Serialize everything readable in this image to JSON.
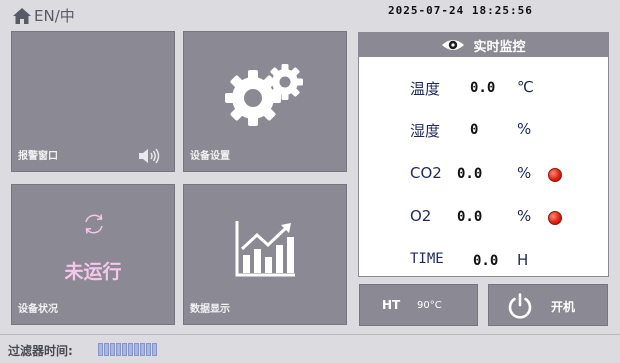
{
  "header": {
    "language_toggle": "EN/中",
    "datetime": "2025-07-24  18:25:56",
    "home_icon": "home-icon"
  },
  "tiles": {
    "alarm": {
      "label": "报警窗口",
      "icon": "speaker-icon"
    },
    "settings": {
      "label": "设备设置",
      "icon": "gears-icon"
    },
    "status": {
      "label": "设备状况",
      "state": "未运行",
      "icon": "refresh-icon"
    },
    "data": {
      "label": "数据显示",
      "icon": "bar-chart-icon"
    }
  },
  "monitor": {
    "title": "实时监控",
    "icon": "eye-icon",
    "rows": [
      {
        "label": "温度",
        "value": "0.0",
        "unit": "℃"
      },
      {
        "label": "湿度",
        "value": "0",
        "unit": "%"
      },
      {
        "label": "CO2",
        "value": "0.0",
        "unit": "%",
        "indicator": "red"
      },
      {
        "label": "O2",
        "value": "0.0",
        "unit": "%",
        "indicator": "red"
      },
      {
        "label": "TIME",
        "value": "0.0",
        "unit": "H"
      }
    ]
  },
  "heater": {
    "label": "HT",
    "value": "90°C"
  },
  "power": {
    "label": "开机",
    "icon": "power-icon"
  },
  "footer": {
    "filter_label": "过滤器时间:",
    "filter_level": 1.0
  },
  "colors": {
    "background": "#dcdbe0",
    "tile": "#8b8993",
    "status_text": "#f5c7ec",
    "indicator_red": "#e02312",
    "filter_bar": "#a9b6dd"
  }
}
